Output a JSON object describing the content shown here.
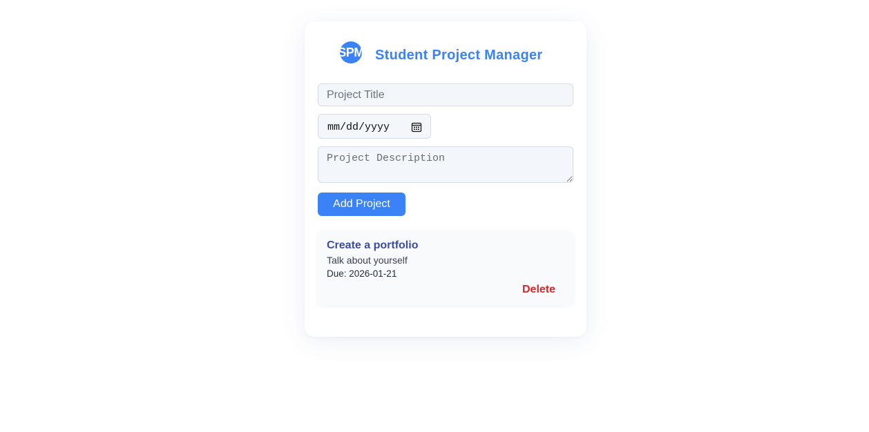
{
  "app": {
    "logo_text": "SPM",
    "title": "Student Project Manager",
    "brand_color": "#3b82f6"
  },
  "form": {
    "title_placeholder": "Project Title",
    "title_value": "",
    "date_placeholder": "mm/dd/yyyy",
    "date_icon": "calendar-icon",
    "description_placeholder": "Project Description",
    "description_value": "",
    "add_button_label": "Add Project"
  },
  "projects": [
    {
      "title": "Create a portfolio",
      "description": "Talk about yourself",
      "due": "Due: 2026-01-21",
      "delete_label": "Delete",
      "delete_color": "#dc2626"
    }
  ]
}
